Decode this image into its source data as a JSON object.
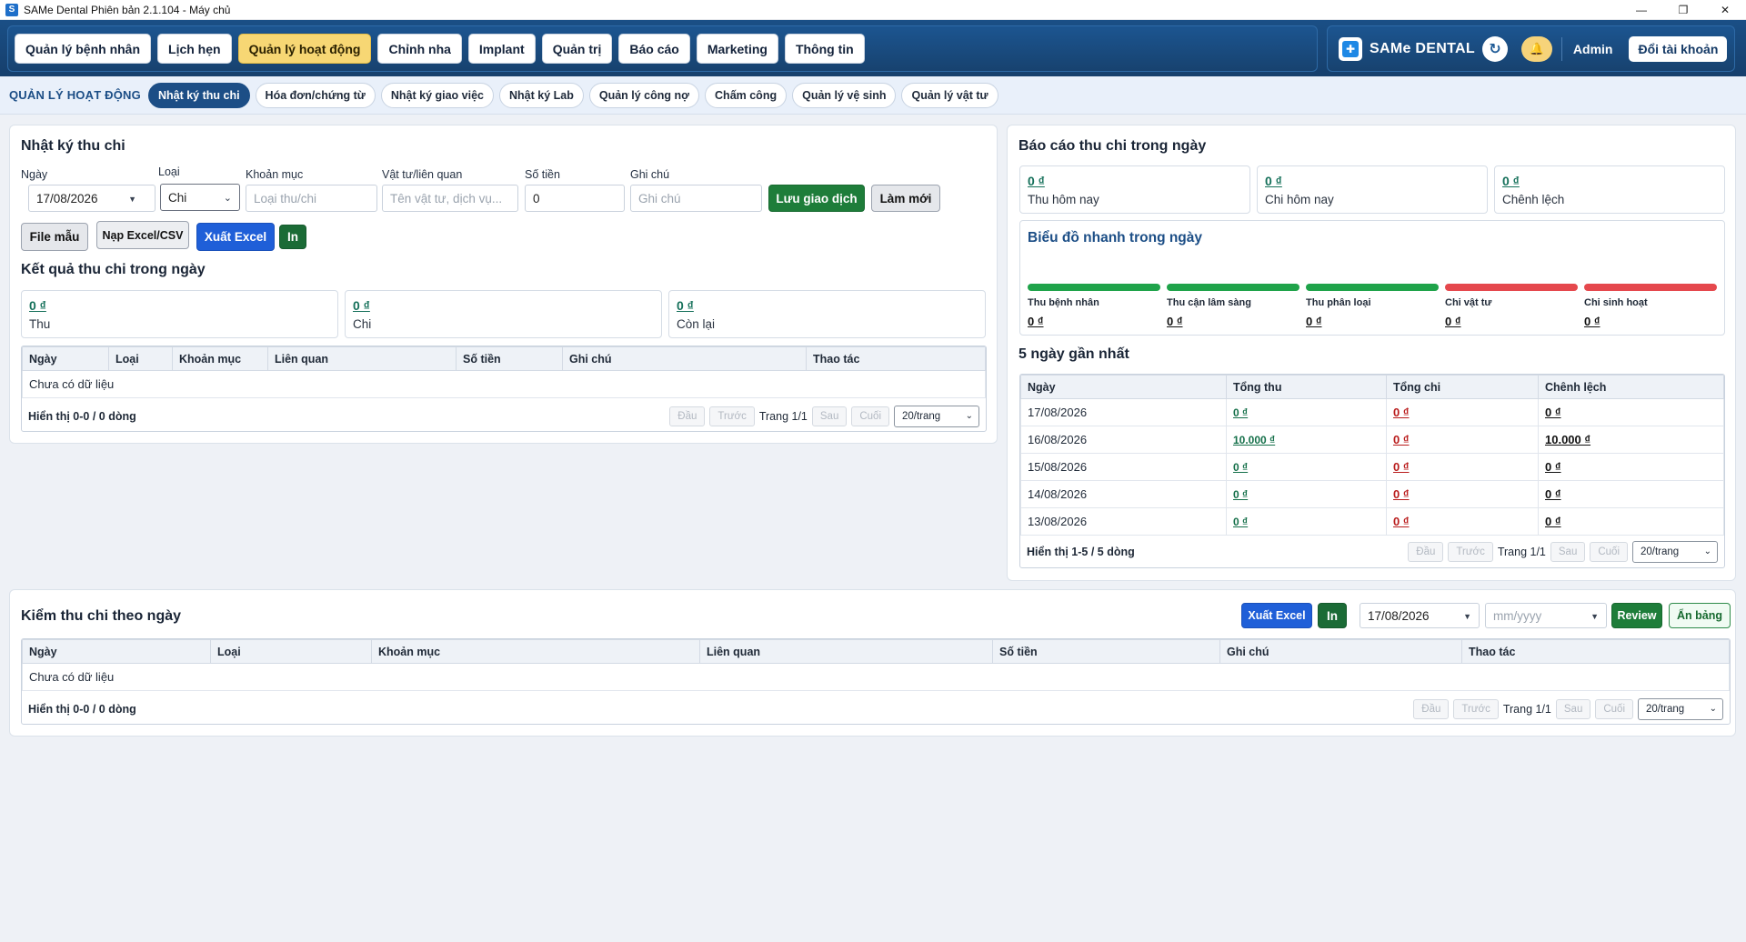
{
  "window": {
    "title": "SAMe Dental Phiên bản 2.1.104 - Máy chủ",
    "minimize": "—",
    "maximize": "❐",
    "close": "✕"
  },
  "topnav": {
    "items": [
      "Quản lý bệnh nhân",
      "Lịch hẹn",
      "Quản lý hoạt động",
      "Chỉnh nha",
      "Implant",
      "Quản trị",
      "Báo cáo",
      "Marketing",
      "Thông tin"
    ],
    "active_index": 2,
    "brand": "SAMe DENTAL",
    "user": "Admin",
    "switch_account": "Đổi tài khoản"
  },
  "subnav": {
    "section": "QUẢN LÝ HOẠT ĐỘNG",
    "items": [
      "Nhật ký thu chi",
      "Hóa đơn/chứng từ",
      "Nhật ký giao việc",
      "Nhật ký Lab",
      "Quản lý công nợ",
      "Chấm công",
      "Quản lý vệ sinh",
      "Quản lý vật tư"
    ],
    "active_index": 0
  },
  "journal": {
    "title": "Nhật ký thu chi",
    "labels": {
      "date": "Ngày",
      "type": "Loại",
      "category": "Khoản mục",
      "related": "Vật tư/liên quan",
      "amount": "Số tiền",
      "note": "Ghi chú"
    },
    "date_value": "17/08/2026",
    "type_value": "Chi",
    "category_placeholder": "Loại thu/chi",
    "related_placeholder": "Tên vật tư, dịch vụ...",
    "amount_value": "0",
    "note_placeholder": "Ghi chú",
    "save": "Lưu giao dịch",
    "reset": "Làm mới",
    "template": "File mẫu",
    "import": "Nạp Excel/CSV",
    "export": "Xuất Excel",
    "print": "In"
  },
  "result": {
    "title": "Kết quả thu chi trong ngày",
    "stats": [
      {
        "value": "0 ₫",
        "label": "Thu"
      },
      {
        "value": "0 ₫",
        "label": "Chi"
      },
      {
        "value": "0 ₫",
        "label": "Còn lại"
      }
    ],
    "columns": [
      "Ngày",
      "Loại",
      "Khoản mục",
      "Liên quan",
      "Số tiền",
      "Ghi chú",
      "Thao tác"
    ],
    "empty": "Chưa có dữ liệu",
    "count": "Hiển thị 0-0 / 0 dòng",
    "pager": {
      "first": "Đầu",
      "prev": "Trước",
      "page": "Trang 1/1",
      "next": "Sau",
      "last": "Cuối",
      "per_page": "20/trang"
    }
  },
  "daily_report": {
    "title": "Báo cáo thu chi trong ngày",
    "stats": [
      {
        "value": "0 ₫",
        "label": "Thu hôm nay"
      },
      {
        "value": "0 ₫",
        "label": "Chi hôm nay"
      },
      {
        "value": "0 ₫",
        "label": "Chênh lệch"
      }
    ],
    "quick_chart": {
      "title": "Biểu đồ nhanh trong ngày",
      "items": [
        {
          "label": "Thu bệnh nhân",
          "value": "0 ₫",
          "color": "#1fa34a"
        },
        {
          "label": "Thu cận lâm sàng",
          "value": "0 ₫",
          "color": "#1fa34a"
        },
        {
          "label": "Thu phân loại",
          "value": "0 ₫",
          "color": "#1fa34a"
        },
        {
          "label": "Chi vật tư",
          "value": "0 ₫",
          "color": "#e5484d"
        },
        {
          "label": "Chi sinh hoạt",
          "value": "0 ₫",
          "color": "#e5484d"
        }
      ]
    }
  },
  "last5": {
    "title": "5 ngày gần nhất",
    "columns": [
      "Ngày",
      "Tổng thu",
      "Tổng chi",
      "Chênh lệch"
    ],
    "rows": [
      {
        "date": "17/08/2026",
        "income": "0 ₫",
        "expense": "0 ₫",
        "diff": "0 ₫"
      },
      {
        "date": "16/08/2026",
        "income": "10.000 ₫",
        "expense": "0 ₫",
        "diff": "10.000 ₫"
      },
      {
        "date": "15/08/2026",
        "income": "0 ₫",
        "expense": "0 ₫",
        "diff": "0 ₫"
      },
      {
        "date": "14/08/2026",
        "income": "0 ₫",
        "expense": "0 ₫",
        "diff": "0 ₫"
      },
      {
        "date": "13/08/2026",
        "income": "0 ₫",
        "expense": "0 ₫",
        "diff": "0 ₫"
      }
    ],
    "count": "Hiển thị 1-5 / 5 dòng",
    "pager": {
      "first": "Đầu",
      "prev": "Trước",
      "page": "Trang 1/1",
      "next": "Sau",
      "last": "Cuối",
      "per_page": "20/trang"
    }
  },
  "audit": {
    "title": "Kiểm thu chi theo ngày",
    "export": "Xuất Excel",
    "print": "In",
    "date_value": "17/08/2026",
    "month_placeholder": "mm/yyyy",
    "review": "Review",
    "hide": "Ẩn bảng",
    "columns": [
      "Ngày",
      "Loại",
      "Khoản mục",
      "Liên quan",
      "Số tiền",
      "Ghi chú",
      "Thao tác"
    ],
    "empty": "Chưa có dữ liệu",
    "count": "Hiển thị 0-0 / 0 dòng",
    "pager": {
      "first": "Đầu",
      "prev": "Trước",
      "page": "Trang 1/1",
      "next": "Sau",
      "last": "Cuối",
      "per_page": "20/trang"
    }
  }
}
